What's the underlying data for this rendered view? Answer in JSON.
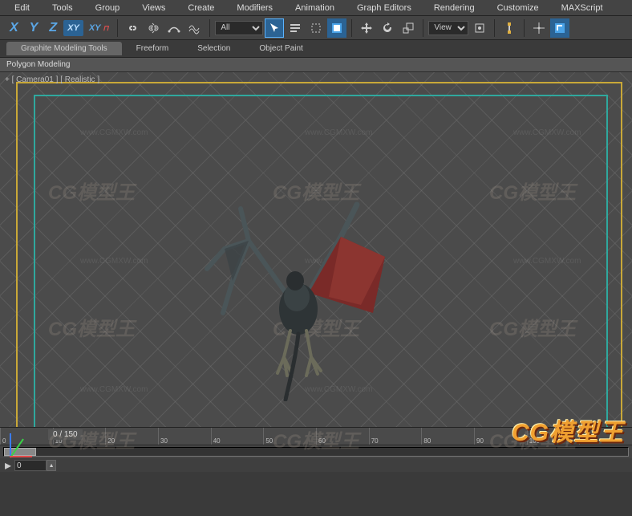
{
  "menu": [
    "Edit",
    "Tools",
    "Group",
    "Views",
    "Create",
    "Modifiers",
    "Animation",
    "Graph Editors",
    "Rendering",
    "Customize",
    "MAXScript"
  ],
  "axes": {
    "x": "X",
    "y": "Y",
    "z": "Z",
    "xy": "XY",
    "xym": "XY"
  },
  "selection_dropdown": "All",
  "view_dropdown": "View",
  "ribbon_tabs": [
    "Graphite Modeling Tools",
    "Freeform",
    "Selection",
    "Object Paint"
  ],
  "ribbon_sub": "Polygon Modeling",
  "viewport_label": "+ [ Camera01 ] [ Realistic ]",
  "timeline": {
    "frame_display": "0 / 150",
    "start": "0",
    "ticks": [
      "0",
      "10",
      "20",
      "30",
      "40",
      "50",
      "60",
      "70",
      "80",
      "90",
      "100",
      "110"
    ]
  },
  "watermark_small": "www.CGMXW.com",
  "watermark_big": "CG模型王",
  "watermark_corner": "CG模型王"
}
